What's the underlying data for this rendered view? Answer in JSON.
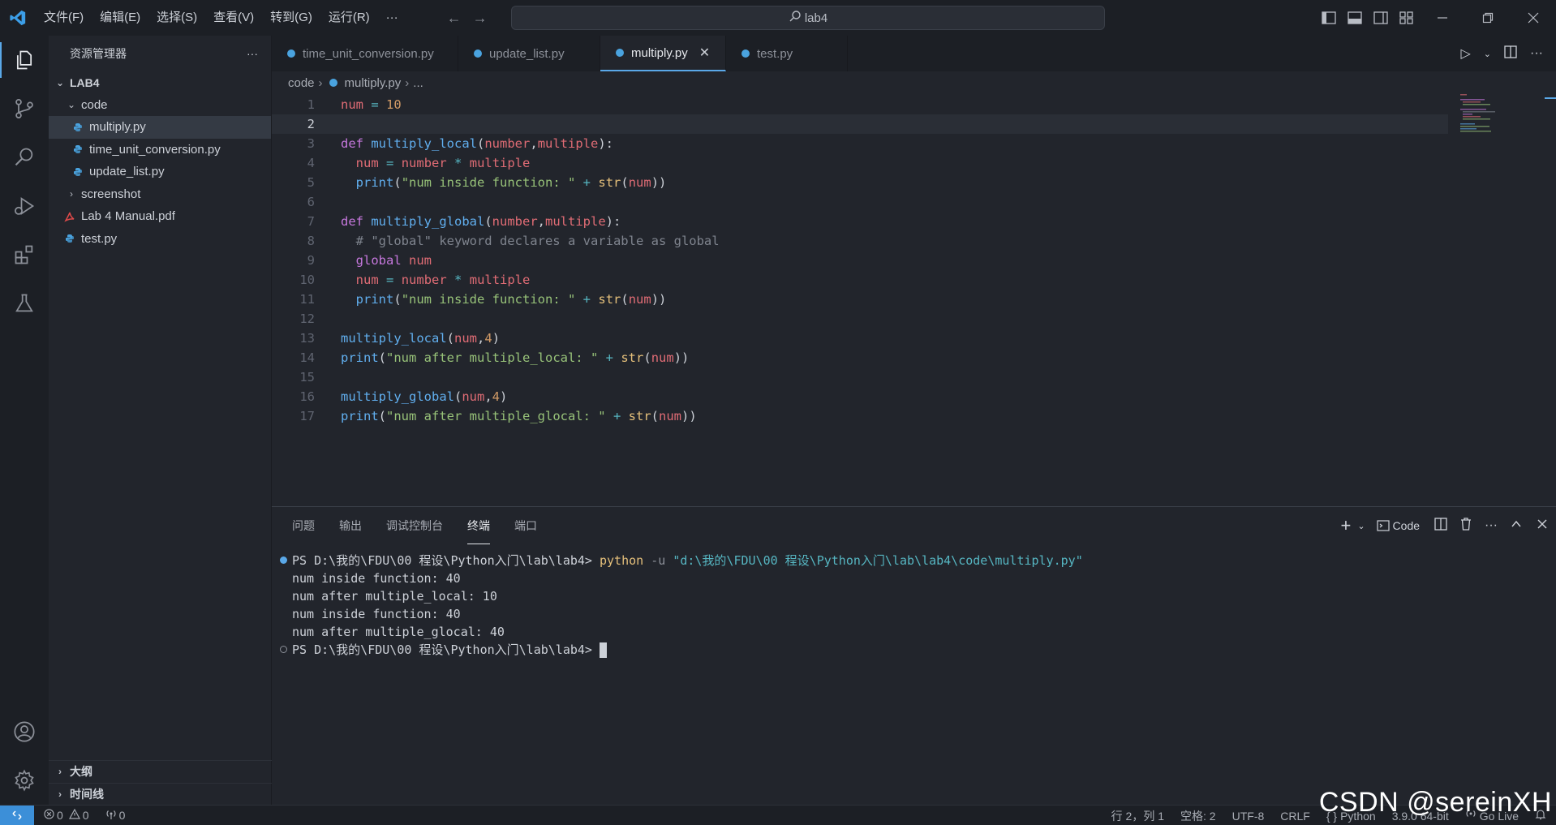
{
  "titlebar": {
    "menu": [
      "文件(F)",
      "编辑(E)",
      "选择(S)",
      "查看(V)",
      "转到(G)",
      "运行(R)",
      "···"
    ],
    "search_text": "lab4"
  },
  "sidebar": {
    "title": "资源管理器",
    "more": "···",
    "root": "LAB4",
    "items": [
      {
        "label": "code",
        "type": "folder",
        "expanded": true
      },
      {
        "label": "multiply.py",
        "type": "python",
        "selected": true
      },
      {
        "label": "time_unit_conversion.py",
        "type": "python"
      },
      {
        "label": "update_list.py",
        "type": "python"
      },
      {
        "label": "screenshot",
        "type": "folder",
        "expanded": false
      },
      {
        "label": "Lab 4 Manual.pdf",
        "type": "pdf"
      },
      {
        "label": "test.py",
        "type": "python"
      }
    ],
    "outline": "大纲",
    "timeline": "时间线"
  },
  "tabs": [
    {
      "label": "time_unit_conversion.py",
      "active": false
    },
    {
      "label": "update_list.py",
      "active": false
    },
    {
      "label": "multiply.py",
      "active": true
    },
    {
      "label": "test.py",
      "active": false
    }
  ],
  "breadcrumb": {
    "folder": "code",
    "file": "multiply.py",
    "rest": "..."
  },
  "editor": {
    "line_numbers": [
      "1",
      "2",
      "3",
      "4",
      "5",
      "6",
      "7",
      "8",
      "9",
      "10",
      "11",
      "12",
      "13",
      "14",
      "15",
      "16",
      "17"
    ],
    "current_line": "2"
  },
  "panel": {
    "tabs": [
      "问题",
      "输出",
      "调试控制台",
      "终端",
      "端口"
    ],
    "active_tab": "终端",
    "shell_label": "Code",
    "terminal": {
      "prompt1": "PS D:\\我的\\FDU\\00 程设\\Python入门\\lab\\lab4> ",
      "cmd": "python",
      "flag": " -u ",
      "arg": "\"d:\\我的\\FDU\\00 程设\\Python入门\\lab\\lab4\\code\\multiply.py\"",
      "out1": "num inside function: 40",
      "out2": "num after multiple_local: 10",
      "out3": "num inside function: 40",
      "out4": "num after multiple_glocal: 40",
      "prompt2": "PS D:\\我的\\FDU\\00 程设\\Python入门\\lab\\lab4> "
    }
  },
  "statusbar": {
    "errors": "0",
    "warnings": "0",
    "ports": "0",
    "position": "行 2，列 1",
    "spaces": "空格: 2",
    "encoding": "UTF-8",
    "eol": "CRLF",
    "language": "Python",
    "interpreter": "3.9.0 64-bit",
    "golive": "Go Live"
  },
  "watermark": "CSDN @sereinXH",
  "colors": {
    "accent": "#5aa8e8",
    "remote": "#3c8fd8",
    "python_icon": "#4aa3df",
    "pdf_icon": "#e04a4a"
  }
}
